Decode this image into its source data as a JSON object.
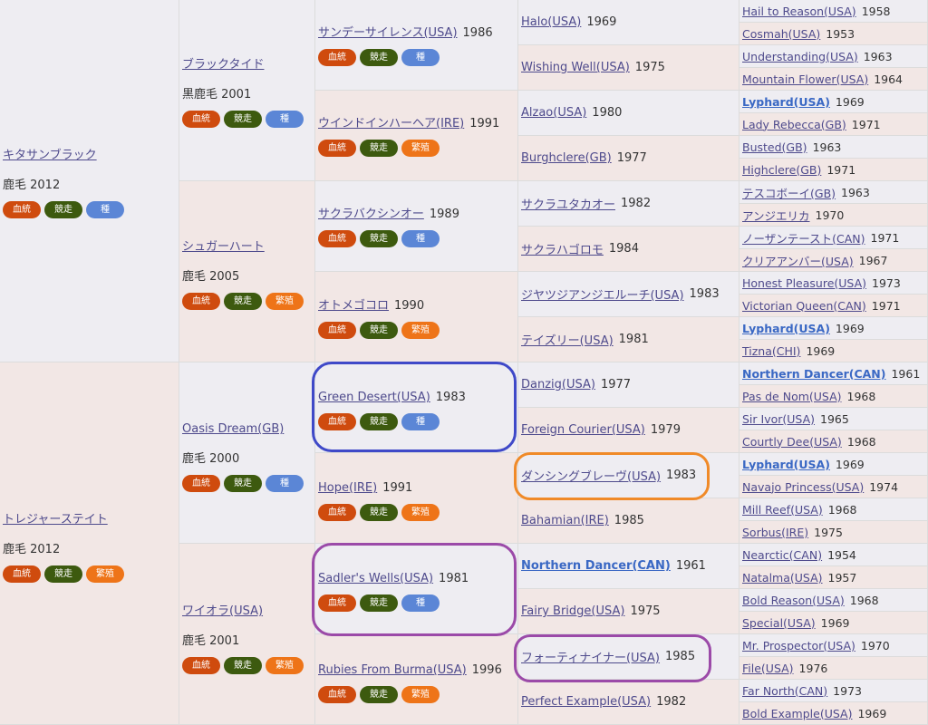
{
  "badges": {
    "blood": "血統",
    "race": "競走",
    "sire": "種",
    "mare": "繁殖"
  },
  "gen1": [
    {
      "name": "キタサンブラック",
      "color": "鹿毛 2012",
      "third": "sire"
    },
    {
      "name": "トレジャーステイト",
      "color": "鹿毛 2012",
      "third": "mare"
    }
  ],
  "gen2": [
    {
      "name": "ブラックタイド",
      "color": "黒鹿毛 2001",
      "third": "sire"
    },
    {
      "name": "シュガーハート",
      "color": "鹿毛 2005",
      "third": "mare"
    },
    {
      "name": "Oasis Dream(GB)",
      "color": "鹿毛 2000",
      "third": "sire"
    },
    {
      "name": "ワイオラ(USA)",
      "color": "鹿毛 2001",
      "third": "mare"
    }
  ],
  "gen3": [
    {
      "name": "サンデーサイレンス(USA)",
      "year": "1986",
      "third": "sire"
    },
    {
      "name": "ウインドインハーヘア(IRE)",
      "year": "1991",
      "third": "mare"
    },
    {
      "name": "サクラバクシンオー",
      "year": "1989",
      "third": "sire"
    },
    {
      "name": "オトメゴコロ",
      "year": "1990",
      "third": "mare"
    },
    {
      "name": "Green Desert(USA)",
      "year": "1983",
      "third": "sire"
    },
    {
      "name": "Hope(IRE)",
      "year": "1991",
      "third": "mare"
    },
    {
      "name": "Sadler's Wells(USA)",
      "year": "1981",
      "third": "sire"
    },
    {
      "name": "Rubies From Burma(USA)",
      "year": "1996",
      "third": "mare"
    }
  ],
  "gen4": [
    {
      "name": "Halo(USA)",
      "year": "1969"
    },
    {
      "name": "Wishing Well(USA)",
      "year": "1975"
    },
    {
      "name": "Alzao(USA)",
      "year": "1980"
    },
    {
      "name": "Burghclere(GB)",
      "year": "1977"
    },
    {
      "name": "サクラユタカオー",
      "year": "1982"
    },
    {
      "name": "サクラハゴロモ",
      "year": "1984"
    },
    {
      "name": "ジヤツジアンジエルーチ(USA)",
      "year": "1983"
    },
    {
      "name": "テイズリー(USA)",
      "year": "1981"
    },
    {
      "name": "Danzig(USA)",
      "year": "1977"
    },
    {
      "name": "Foreign Courier(USA)",
      "year": "1979"
    },
    {
      "name": "ダンシングブレーヴ(USA)",
      "year": "1983"
    },
    {
      "name": "Bahamian(IRE)",
      "year": "1985"
    },
    {
      "name": "Northern Dancer(CAN)",
      "year": "1961",
      "bold": true
    },
    {
      "name": "Fairy Bridge(USA)",
      "year": "1975"
    },
    {
      "name": "フォーティナイナー(USA)",
      "year": "1985"
    },
    {
      "name": "Perfect Example(USA)",
      "year": "1982"
    }
  ],
  "gen5": [
    {
      "name": "Hail to Reason(USA)",
      "year": "1958"
    },
    {
      "name": "Cosmah(USA)",
      "year": "1953"
    },
    {
      "name": "Understanding(USA)",
      "year": "1963"
    },
    {
      "name": "Mountain Flower(USA)",
      "year": "1964"
    },
    {
      "name": "Lyphard(USA)",
      "year": "1969",
      "bold": true
    },
    {
      "name": "Lady Rebecca(GB)",
      "year": "1971"
    },
    {
      "name": "Busted(GB)",
      "year": "1963"
    },
    {
      "name": "Highclere(GB)",
      "year": "1971"
    },
    {
      "name": "テスコボーイ(GB)",
      "year": "1963"
    },
    {
      "name": "アンジエリカ",
      "year": "1970"
    },
    {
      "name": "ノーザンテースト(CAN)",
      "year": "1971"
    },
    {
      "name": "クリアアンバー(USA)",
      "year": "1967"
    },
    {
      "name": "Honest Pleasure(USA)",
      "year": "1973"
    },
    {
      "name": "Victorian Queen(CAN)",
      "year": "1971"
    },
    {
      "name": "Lyphard(USA)",
      "year": "1969",
      "bold": true
    },
    {
      "name": "Tizna(CHI)",
      "year": "1969"
    },
    {
      "name": "Northern Dancer(CAN)",
      "year": "1961",
      "bold": true
    },
    {
      "name": "Pas de Nom(USA)",
      "year": "1968"
    },
    {
      "name": "Sir Ivor(USA)",
      "year": "1965"
    },
    {
      "name": "Courtly Dee(USA)",
      "year": "1968"
    },
    {
      "name": "Lyphard(USA)",
      "year": "1969",
      "bold": true
    },
    {
      "name": "Navajo Princess(USA)",
      "year": "1974"
    },
    {
      "name": "Mill Reef(USA)",
      "year": "1968"
    },
    {
      "name": "Sorbus(IRE)",
      "year": "1975"
    },
    {
      "name": "Nearctic(CAN)",
      "year": "1954"
    },
    {
      "name": "Natalma(USA)",
      "year": "1957"
    },
    {
      "name": "Bold Reason(USA)",
      "year": "1968"
    },
    {
      "name": "Special(USA)",
      "year": "1969"
    },
    {
      "name": "Mr. Prospector(USA)",
      "year": "1970"
    },
    {
      "name": "File(USA)",
      "year": "1976"
    },
    {
      "name": "Far North(CAN)",
      "year": "1973"
    },
    {
      "name": "Bold Example(USA)",
      "year": "1969"
    }
  ]
}
